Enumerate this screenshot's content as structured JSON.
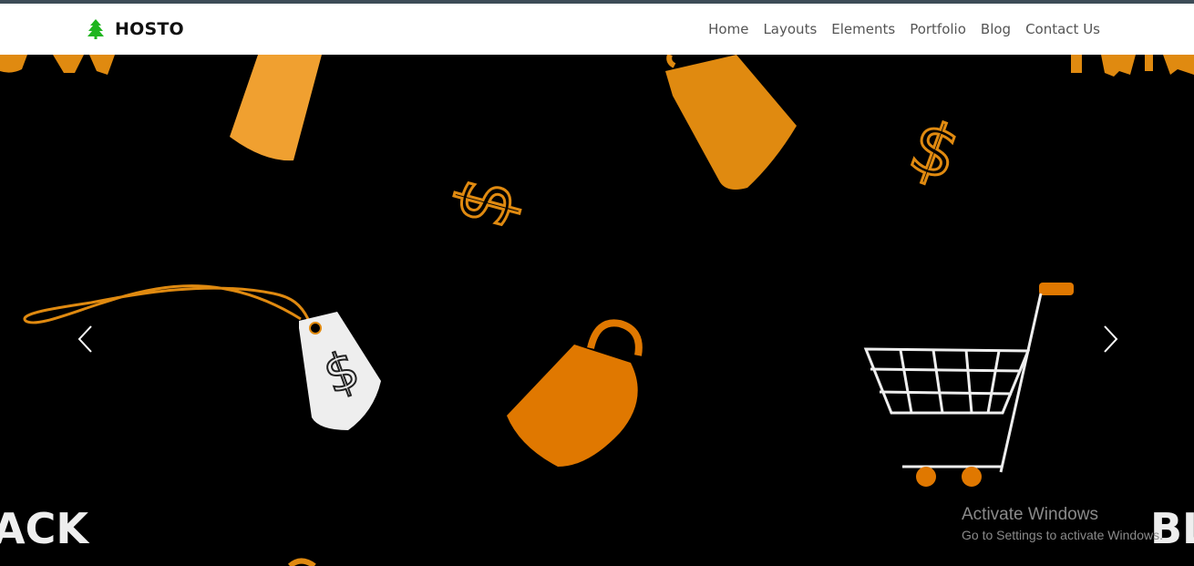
{
  "brand": {
    "name": "HOSTO",
    "logo_icon": "pine-tree-icon",
    "logo_color": "#1fb51f"
  },
  "nav": {
    "items": [
      {
        "label": "Home"
      },
      {
        "label": "Layouts"
      },
      {
        "label": "Elements"
      },
      {
        "label": "Portfolio"
      },
      {
        "label": "Blog"
      },
      {
        "label": "Contact Us"
      }
    ]
  },
  "hero": {
    "background": "#000000",
    "accent_colors": [
      "#f0a030",
      "#e08a10",
      "#e07800"
    ],
    "text_fragments": {
      "left_bottom": "ACK",
      "right_bottom": "BL"
    },
    "prev_icon": "chevron-left-icon",
    "next_icon": "chevron-right-icon"
  },
  "watermark": {
    "title": "Activate Windows",
    "subtitle": "Go to Settings to activate Windows."
  }
}
